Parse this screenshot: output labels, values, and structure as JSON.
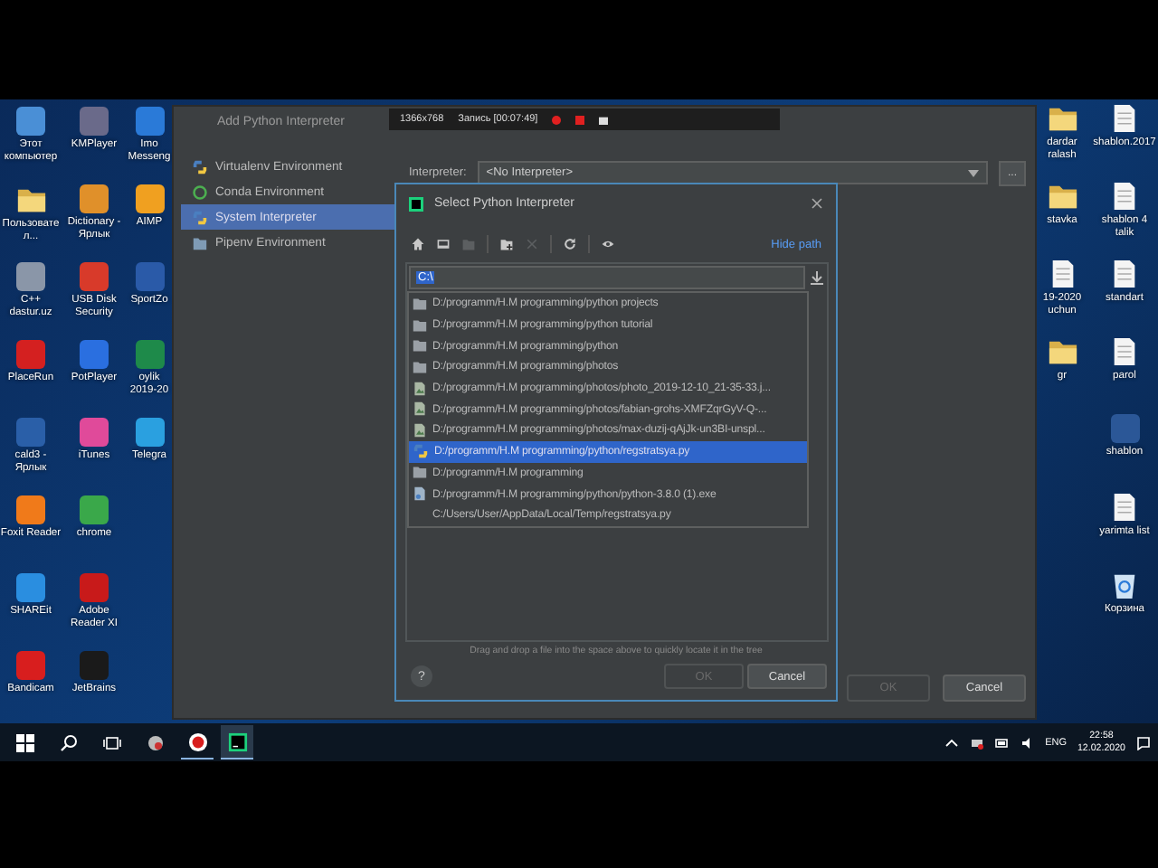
{
  "recorder_bar": {
    "resolution": "1366x768",
    "status": "Запись [00:07:49]"
  },
  "desktop_left_columns": [
    [
      {
        "label": "Этот компьютер",
        "kind": "app",
        "color": "#4a8fd6"
      },
      {
        "label": "Пользовател...",
        "kind": "folder"
      },
      {
        "label": "C++ dastur.uz",
        "kind": "app",
        "color": "#8a96a8"
      },
      {
        "label": "PlaceRun",
        "kind": "app",
        "color": "#d42020"
      },
      {
        "label": "cald3 - Ярлык",
        "kind": "app",
        "color": "#2a5fa8"
      },
      {
        "label": "Foxit Reader",
        "kind": "app",
        "color": "#f07a1a"
      },
      {
        "label": "SHAREit",
        "kind": "app",
        "color": "#2a8ee0"
      },
      {
        "label": "Bandicam",
        "kind": "app",
        "color": "#d81e1e"
      }
    ],
    [
      {
        "label": "KMPlayer",
        "kind": "app",
        "color": "#6a6a8a"
      },
      {
        "label": "Dictionary - Ярлык",
        "kind": "app",
        "color": "#e0902a"
      },
      {
        "label": "USB Disk Security",
        "kind": "app",
        "color": "#d83a2a"
      },
      {
        "label": "PotPlayer",
        "kind": "app",
        "color": "#2a6fe0"
      },
      {
        "label": "iTunes",
        "kind": "app",
        "color": "#e04a9a"
      },
      {
        "label": "chrome",
        "kind": "app",
        "color": "#3aa84a"
      },
      {
        "label": "Adobe Reader XI",
        "kind": "app",
        "color": "#c81a1a"
      },
      {
        "label": "JetBrains",
        "kind": "app",
        "color": "#1a1a1a"
      }
    ],
    [
      {
        "label": "Imo Messeng",
        "kind": "app",
        "color": "#2a7ad8"
      },
      {
        "label": "AIMP",
        "kind": "app",
        "color": "#f0a020"
      },
      {
        "label": "SportZo",
        "kind": "app",
        "color": "#2a5aa8"
      },
      {
        "label": "oylik 2019-20",
        "kind": "app",
        "color": "#1e8a4a"
      },
      {
        "label": "Telegra",
        "kind": "app",
        "color": "#2aa0e0"
      }
    ]
  ],
  "desktop_right_columns": [
    [
      {
        "label": "dardar ralash",
        "kind": "folder"
      },
      {
        "label": "stavka",
        "kind": "folder"
      },
      {
        "label": "19-2020 uchun",
        "kind": "document"
      },
      {
        "label": "gr",
        "kind": "folder"
      }
    ],
    [
      {
        "label": "shablon.2017",
        "kind": "document"
      },
      {
        "label": "shablon 4 talik",
        "kind": "document"
      },
      {
        "label": "standart",
        "kind": "document"
      },
      {
        "label": "parol",
        "kind": "document"
      },
      {
        "label": "shablon",
        "kind": "app",
        "color": "#2b5797"
      },
      {
        "label": "yarimta list",
        "kind": "document"
      },
      {
        "label": "Корзина",
        "kind": "recycle"
      }
    ]
  ],
  "add_interpreter_window": {
    "title": "Add Python Interpreter",
    "sidebar": [
      {
        "label": "Virtualenv Environment",
        "kind": "virtualenv",
        "selected": false
      },
      {
        "label": "Conda Environment",
        "kind": "conda",
        "selected": false
      },
      {
        "label": "System Interpreter",
        "kind": "python",
        "selected": true
      },
      {
        "label": "Pipenv Environment",
        "kind": "pipenv",
        "selected": false
      }
    ],
    "interpreter_label": "Interpreter:",
    "interpreter_value": "<No Interpreter>",
    "browse_button": "...",
    "buttons": [
      {
        "label": "OK",
        "disabled": true
      },
      {
        "label": "Cancel",
        "disabled": false
      }
    ]
  },
  "select_dialog": {
    "title": "Select Python Interpreter",
    "toolbar": [
      {
        "kind": "home",
        "disabled": false
      },
      {
        "kind": "desktop",
        "disabled": false
      },
      {
        "kind": "project",
        "disabled": true
      },
      {
        "kind": "new-folder",
        "disabled": false
      },
      {
        "kind": "delete",
        "disabled": true
      },
      {
        "kind": "refresh",
        "disabled": false
      },
      {
        "kind": "hidden-files",
        "disabled": false
      }
    ],
    "hide_path_link": "Hide path",
    "path": "C:\\",
    "suggestions": [
      {
        "text": "D:/programm/H.M programming/python projects",
        "kind": "folder",
        "selected": false
      },
      {
        "text": "D:/programm/H.M programming/python tutorial",
        "kind": "folder",
        "selected": false
      },
      {
        "text": "D:/programm/H.M programming/python",
        "kind": "folder",
        "selected": false
      },
      {
        "text": "D:/programm/H.M programming/photos",
        "kind": "folder",
        "selected": false
      },
      {
        "text": "D:/programm/H.M programming/photos/photo_2019-12-10_21-35-33.j...",
        "kind": "image",
        "selected": false
      },
      {
        "text": "D:/programm/H.M programming/photos/fabian-grohs-XMFZqrGyV-Q-...",
        "kind": "image",
        "selected": false
      },
      {
        "text": "D:/programm/H.M programming/photos/max-duzij-qAjJk-un3BI-unspl...",
        "kind": "image",
        "selected": false
      },
      {
        "text": "D:/programm/H.M programming/python/regstratsya.py",
        "kind": "python",
        "selected": true
      },
      {
        "text": "D:/programm/H.M programming",
        "kind": "folder",
        "selected": false
      },
      {
        "text": "D:/programm/H.M programming/python/python-3.8.0 (1).exe",
        "kind": "exe",
        "selected": false
      },
      {
        "text": "C:/Users/User/AppData/Local/Temp/regstratsya.py",
        "kind": "none",
        "selected": false
      }
    ],
    "hint": "Drag and drop a file into the space above to quickly locate it in the tree",
    "help_button": "?",
    "buttons": [
      {
        "label": "OK",
        "disabled": true
      },
      {
        "label": "Cancel",
        "disabled": false
      }
    ]
  },
  "taskbar": {
    "apps": [
      {
        "kind": "record",
        "selected": false
      },
      {
        "kind": "pycharm",
        "selected": true
      }
    ],
    "language": "ENG",
    "time": "22:58",
    "date": "12.02.2020"
  }
}
